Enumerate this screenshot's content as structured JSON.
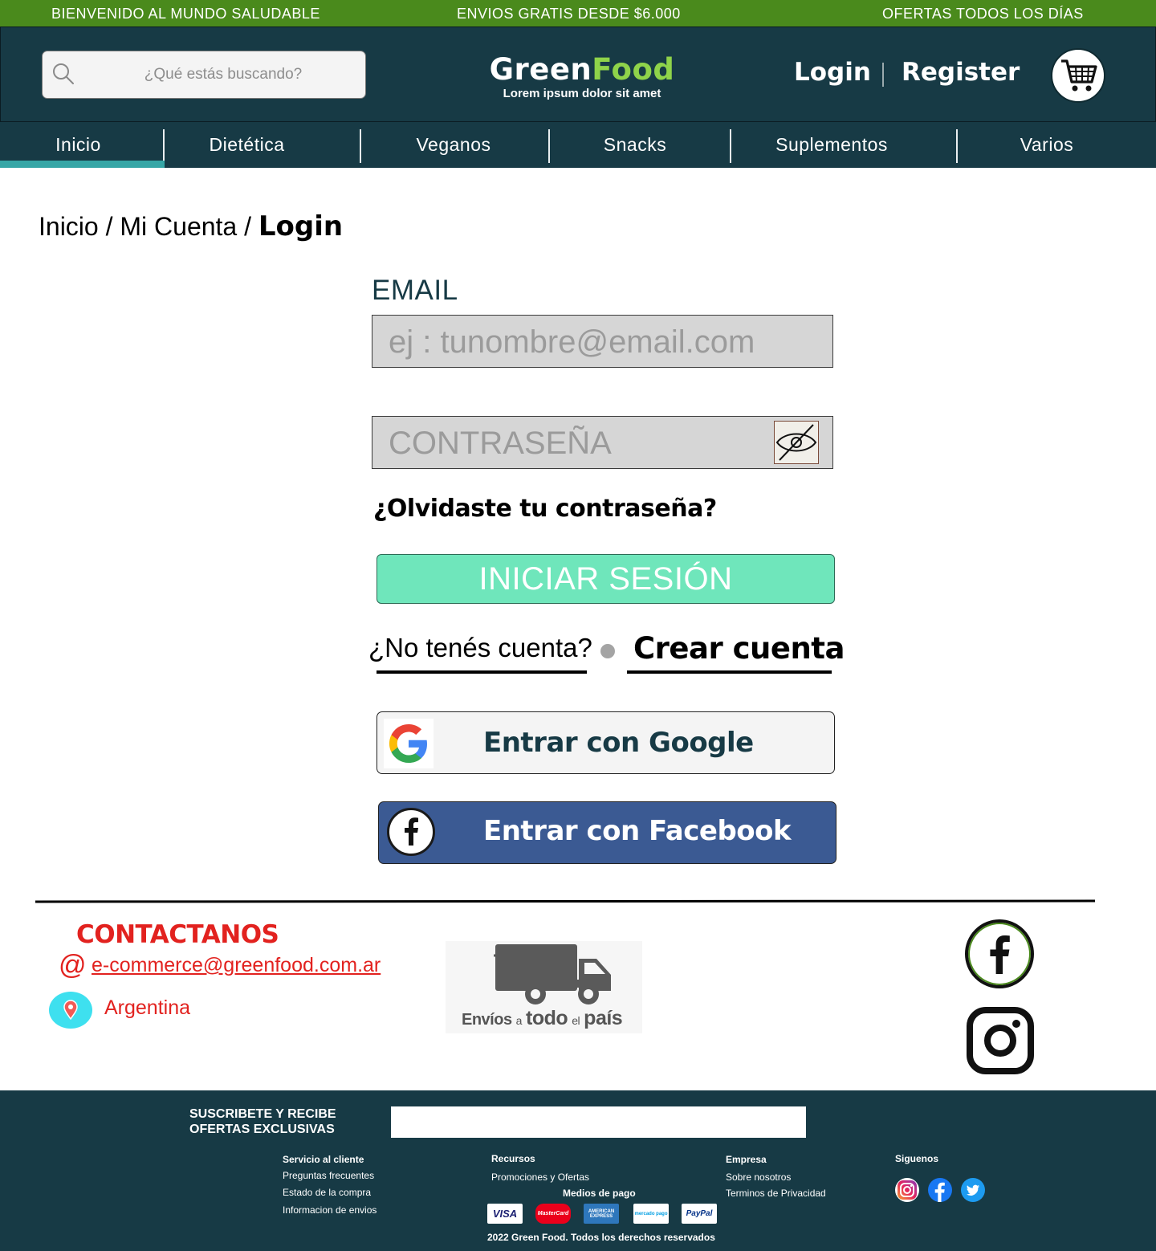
{
  "promo": {
    "left": "BIENVENIDO AL MUNDO SALUDABLE",
    "center": "ENVIOS GRATIS DESDE $6.000",
    "right": "OFERTAS TODOS LOS DÍAS"
  },
  "header": {
    "search_placeholder": "¿Qué estás buscando?",
    "logo_green": "Green",
    "logo_food": "Food",
    "logo_tagline": "Lorem ipsum dolor sit amet",
    "login": "Login",
    "register": "Register"
  },
  "nav": {
    "items": [
      "Inicio",
      "Dietética",
      "Veganos",
      "Snacks",
      "Suplementos",
      "Varios"
    ],
    "active": "Inicio"
  },
  "breadcrumb": {
    "home": "Inicio",
    "sep": "/",
    "account": "Mi Cuenta",
    "current": "Login"
  },
  "form": {
    "email_label": "EMAIL",
    "email_placeholder": "ej : tunombre@email.com",
    "password_placeholder": "CONTRASEÑA",
    "forgot": "¿Olvidaste tu contraseña?",
    "submit": "INICIAR SESIÓN",
    "no_account": "¿No tenés cuenta?",
    "create_account": "Crear cuenta",
    "google": "Entrar con Google",
    "facebook": "Entrar con Facebook"
  },
  "contact": {
    "title": "CONTACTANOS",
    "at": "@",
    "email": "e-commerce@greenfood.com.ar",
    "country": "Argentina",
    "shipping_1": "Envíos",
    "shipping_2": "a",
    "shipping_3": "todo",
    "shipping_4": "el",
    "shipping_5": "país"
  },
  "footer": {
    "subscribe_title": "SUSCRIBETE Y RECIBE OFERTAS EXCLUSIVAS",
    "subscribe_value": "",
    "customer_title": "Servicio al cliente",
    "customer_links": [
      "Preguntas frecuentes",
      "Estado de la compra",
      "Informacion de envios"
    ],
    "resources_title": "Recursos",
    "resources_links": [
      "Promociones y Ofertas"
    ],
    "company_title": "Empresa",
    "company_links": [
      "Sobre nosotros",
      "Terminos de Privacidad"
    ],
    "follow_title": "Siguenos",
    "payment_title": "Medios de pago",
    "payments": [
      "VISA",
      "MasterCard",
      "AMERICAN EXPRESS",
      "mercado pago",
      "PayPal"
    ],
    "copyright": "2022 Green Food. Todos los derechos reservados"
  },
  "colors": {
    "promo_bg": "#4a8a1c",
    "header_bg": "#173a45",
    "accent_teal": "#36a6a6",
    "login_button": "#6fe6bb",
    "facebook_blue": "#3b5a93",
    "contact_red": "#e2221f"
  }
}
